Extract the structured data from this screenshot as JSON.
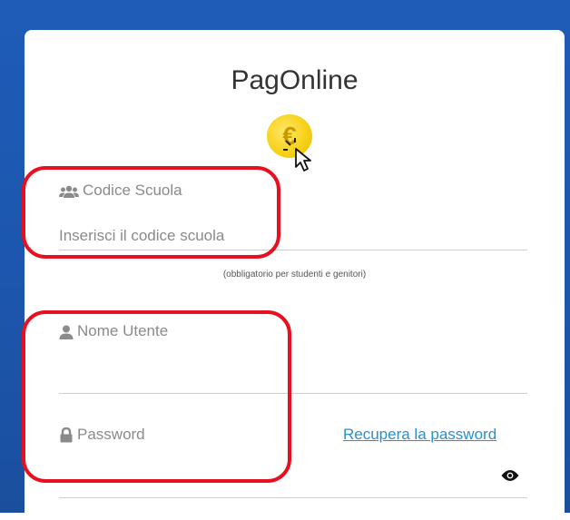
{
  "app": {
    "title": "PagOnline"
  },
  "school_code": {
    "label": "Codice Scuola",
    "placeholder": "Inserisci il codice scuola",
    "hint": "(obbligatorio per studenti e genitori)"
  },
  "username": {
    "label": "Nome Utente",
    "value": ""
  },
  "password": {
    "label": "Password",
    "recover_link": "Recupera la password",
    "value": ""
  },
  "icons": {
    "coin": "euro-coin-icon",
    "cursor": "hand-cursor-icon",
    "school": "users-icon",
    "user": "user-icon",
    "password": "lock-icon",
    "show_password": "eye-icon"
  },
  "colors": {
    "background": "#1f5cb8",
    "accent_link": "#2a8fcf",
    "annotation": "#e8101e",
    "coin": "#f7d21a"
  }
}
